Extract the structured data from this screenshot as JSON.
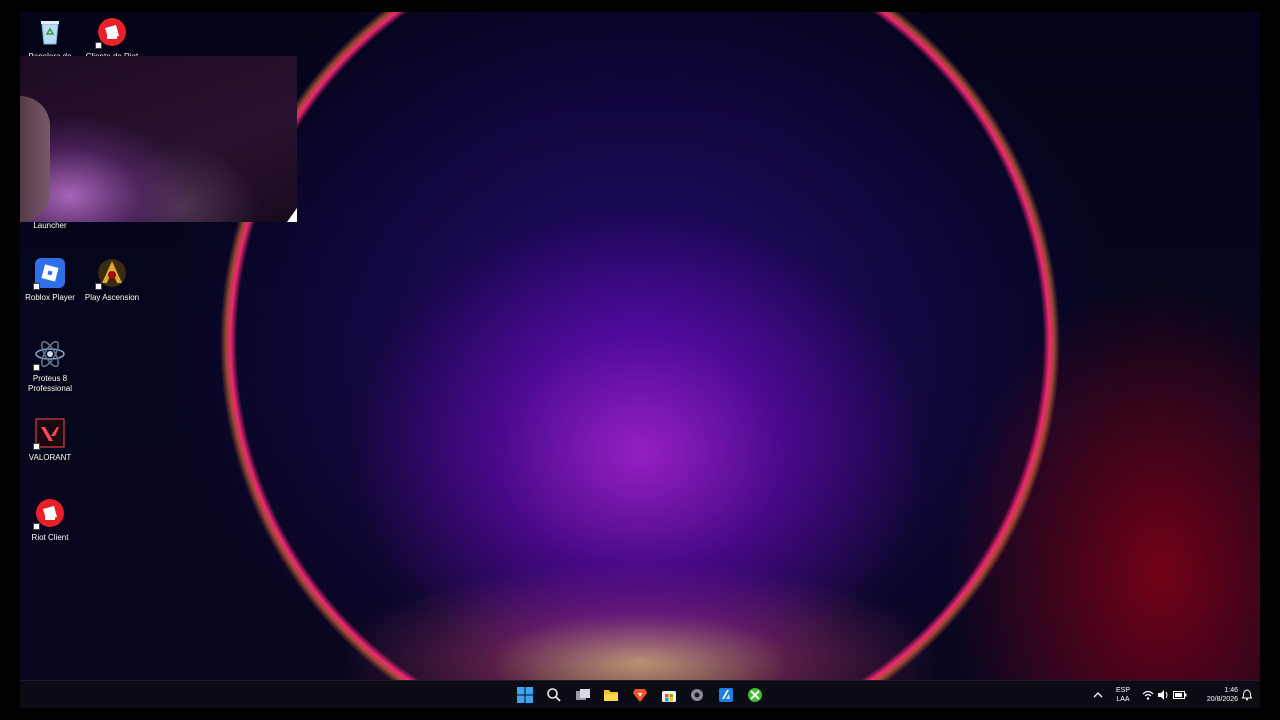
{
  "desktop": {
    "icons": [
      {
        "name": "recycle-bin",
        "label": "Papelera de",
        "color": "#3aa0e8"
      },
      {
        "name": "riot-client-top",
        "label": "Cliente de Riot",
        "color": "#e8202a"
      },
      {
        "name": "launcher",
        "label": "Launcher"
      },
      {
        "name": "roblox",
        "label": "Roblox Player",
        "color": "#2f6fe8"
      },
      {
        "name": "play-ascension",
        "label": "Play Ascension",
        "color": "#c8a030"
      },
      {
        "name": "proteus",
        "label": "Proteus 8 Professional",
        "color": "#6a8ab0"
      },
      {
        "name": "valorant",
        "label": "VALORANT",
        "color": "#ff4655"
      },
      {
        "name": "riot-client",
        "label": "Riot Client",
        "color": "#e8202a"
      }
    ]
  },
  "taskbar": {
    "pinned": [
      "windows-start",
      "search",
      "task-view",
      "file-explorer",
      "brave",
      "microsoft-store",
      "settings",
      "azure-app",
      "xbox"
    ],
    "tray": {
      "language": "ESP",
      "language_sub": "LAA",
      "time": "1:46",
      "date": "20/8/2026"
    }
  }
}
